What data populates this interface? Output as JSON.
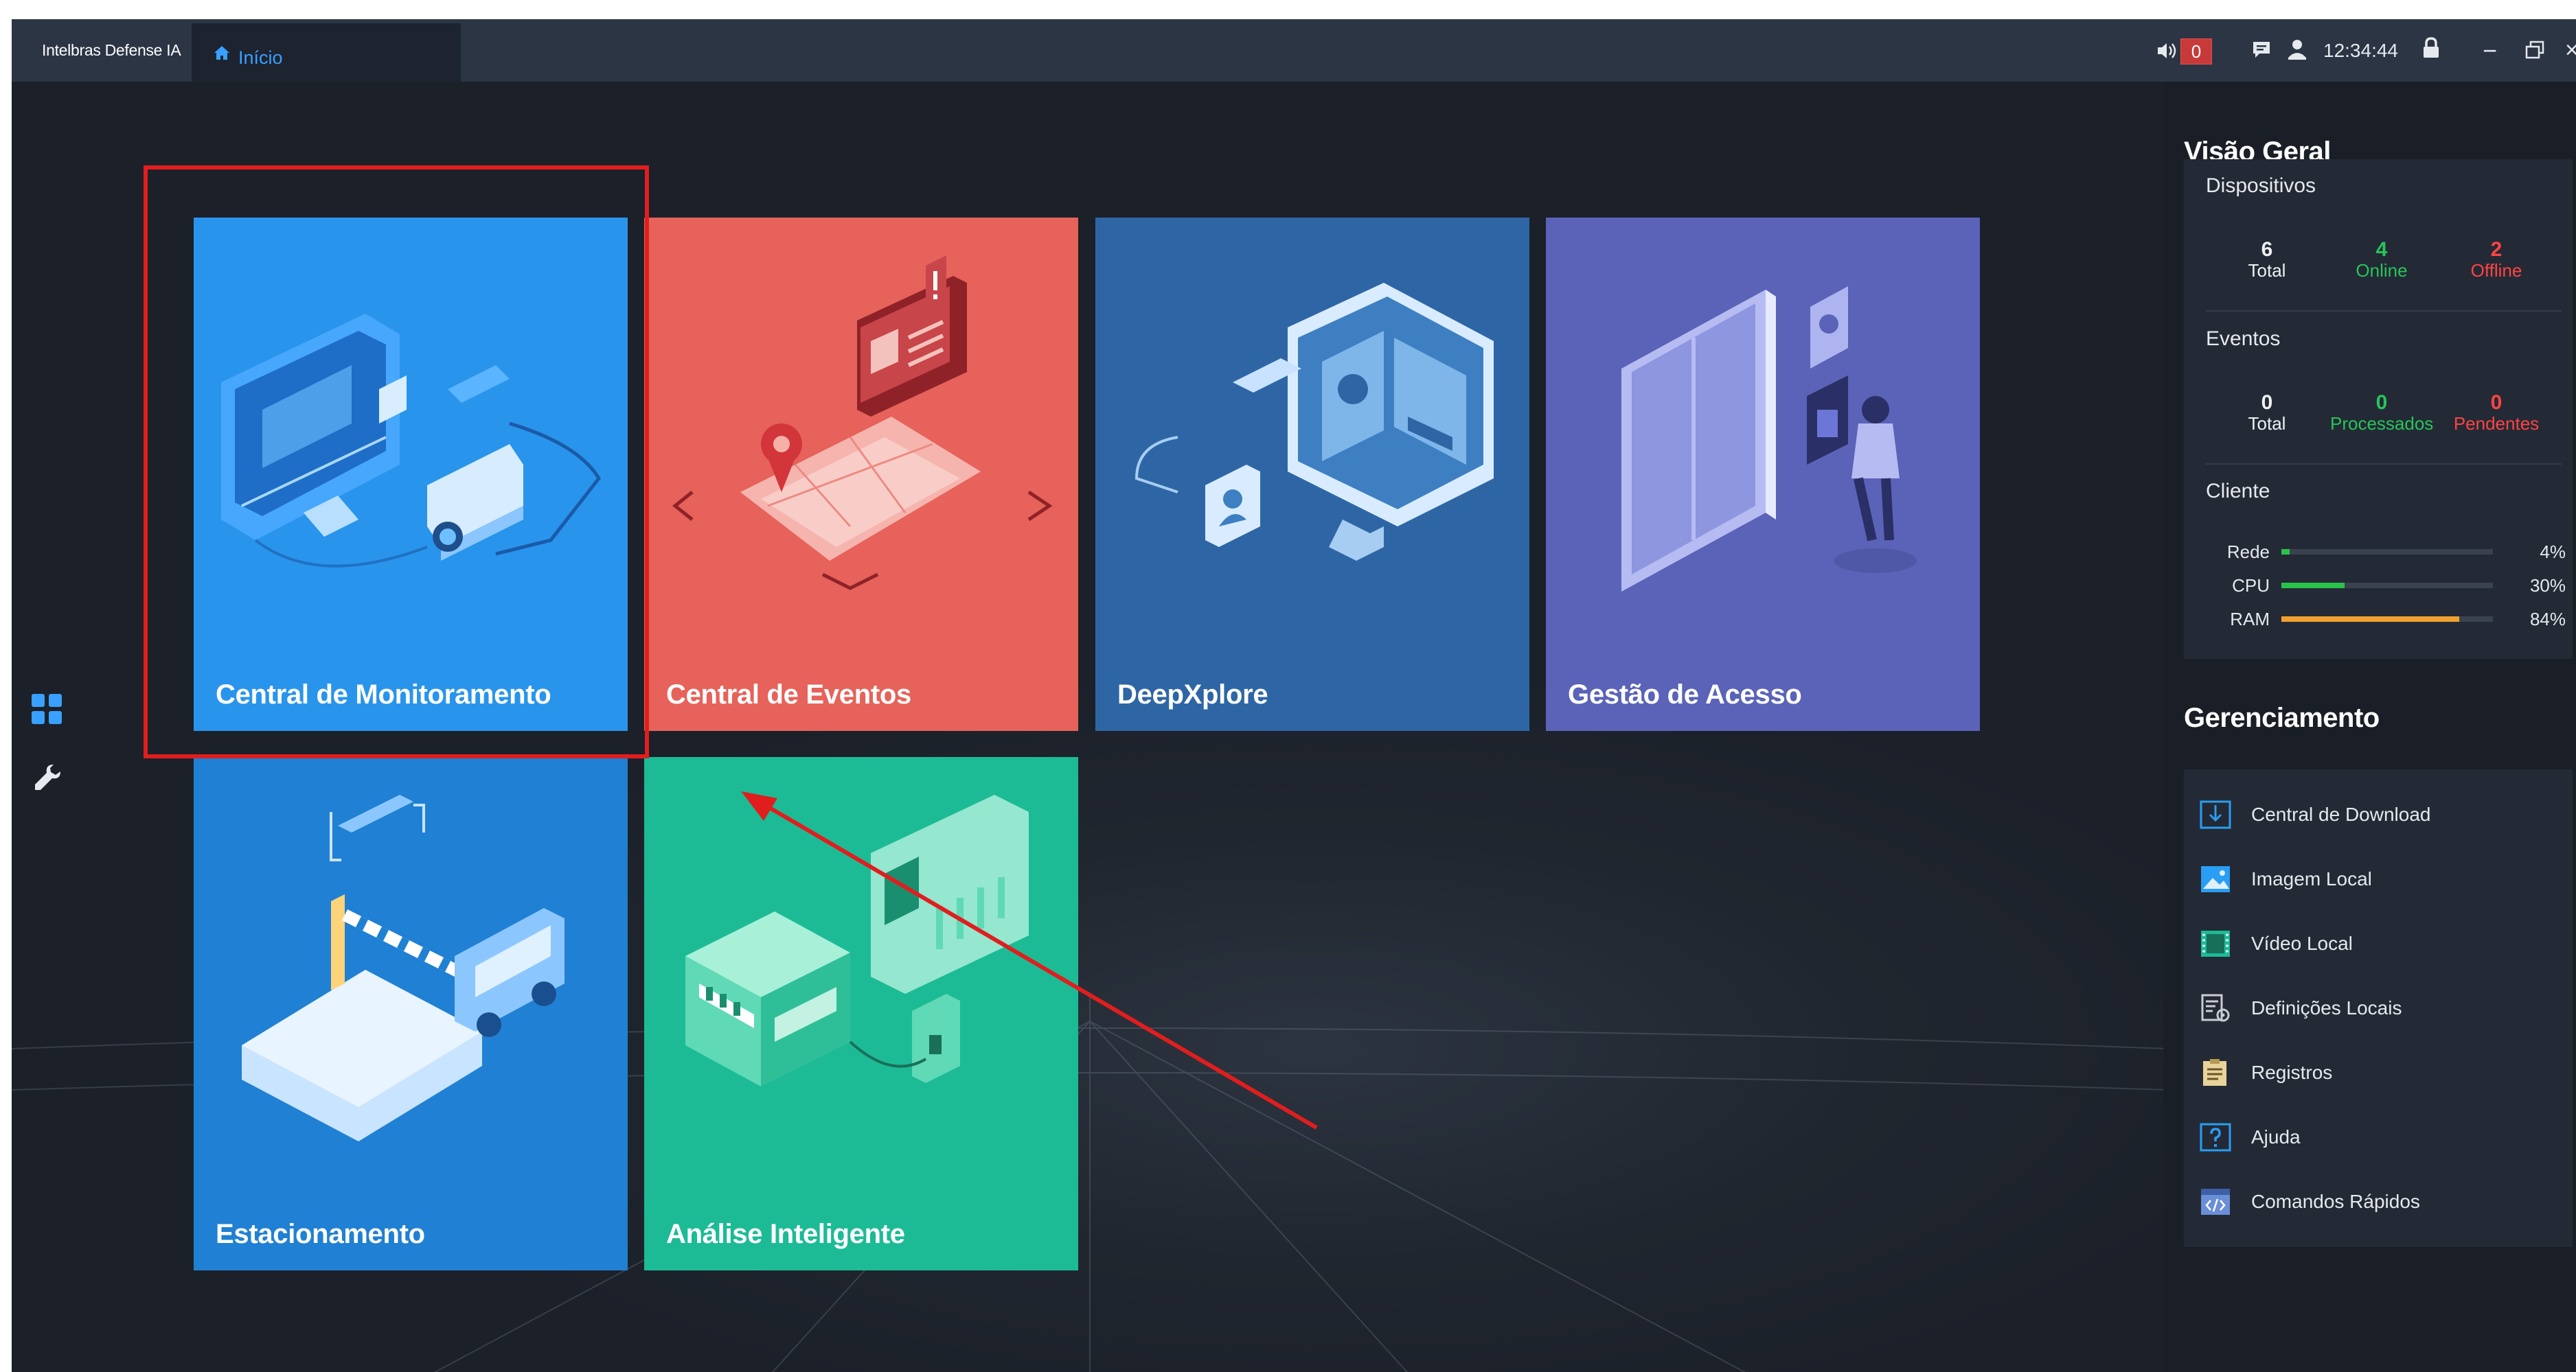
{
  "titlebar": {
    "brand": "Intelbras Defense IA",
    "home_tab_label": "Início",
    "alarm_count": "0",
    "clock": "12:34:44",
    "minimize": "−",
    "close": "×"
  },
  "tiles": {
    "monitoramento": "Central de Monitoramento",
    "eventos": "Central de Eventos",
    "deepxplore": "DeepXplore",
    "acesso": "Gestão de Acesso",
    "estacionamento": "Estacionamento",
    "analise": "Análise Inteligente"
  },
  "overview": {
    "title": "Visão Geral",
    "devices": {
      "heading": "Dispositivos",
      "total": "6",
      "total_label": "Total",
      "online": "4",
      "online_label": "Online",
      "offline": "2",
      "offline_label": "Offline"
    },
    "events": {
      "heading": "Eventos",
      "total": "0",
      "total_label": "Total",
      "processed": "0",
      "processed_label": "Processados",
      "pending": "0",
      "pending_label": "Pendentes"
    },
    "client": {
      "heading": "Cliente",
      "metrics": [
        {
          "label": "Rede",
          "value": "4%",
          "fraction": 0.04,
          "color": "#2bc24a"
        },
        {
          "label": "CPU",
          "value": "30%",
          "fraction": 0.3,
          "color": "#2bc24a"
        },
        {
          "label": "RAM",
          "value": "84%",
          "fraction": 0.84,
          "color": "#f0a030"
        }
      ]
    }
  },
  "management": {
    "title": "Gerenciamento",
    "items": [
      {
        "label": "Central de Download",
        "icon": "download-icon"
      },
      {
        "label": "Imagem Local",
        "icon": "image-icon"
      },
      {
        "label": "Vídeo Local",
        "icon": "film-icon"
      },
      {
        "label": "Definições Locais",
        "icon": "settings-doc-icon"
      },
      {
        "label": "Registros",
        "icon": "log-icon"
      },
      {
        "label": "Ajuda",
        "icon": "help-icon"
      },
      {
        "label": "Comandos Rápidos",
        "icon": "code-icon"
      }
    ]
  },
  "colors": {
    "accent": "#3aa0ff",
    "highlight": "#e01e1e",
    "online": "#28c45a",
    "offline": "#ff4444"
  }
}
